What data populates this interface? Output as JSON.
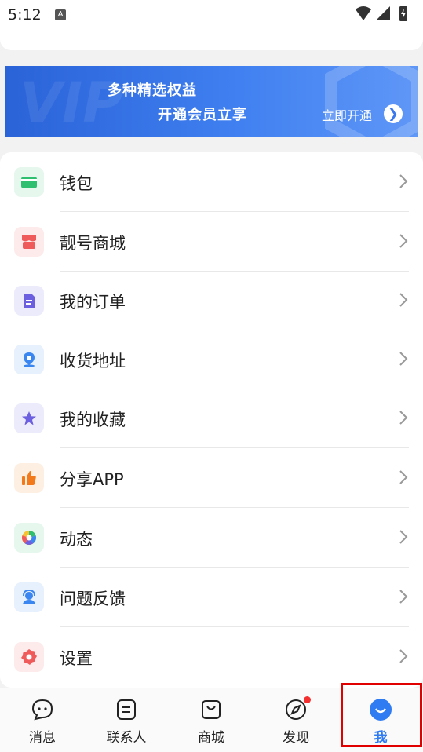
{
  "status_bar": {
    "time": "5:12",
    "notif_letter": "A"
  },
  "vip_banner": {
    "line1": "多种精选权益",
    "line2": "开通会员立享",
    "cta": "立即开通",
    "deco_text": "VIP"
  },
  "menu": {
    "items": [
      {
        "label": "钱包",
        "icon": "wallet-icon",
        "color": "#2fbf71",
        "bg": "#e6f7ee"
      },
      {
        "label": "靓号商城",
        "icon": "store-icon",
        "color": "#ef5b5b",
        "bg": "#fdeaea"
      },
      {
        "label": "我的订单",
        "icon": "order-icon",
        "color": "#6c5fe0",
        "bg": "#ecebfb"
      },
      {
        "label": "收货地址",
        "icon": "location-icon",
        "color": "#3a86f0",
        "bg": "#e7f0fd"
      },
      {
        "label": "我的收藏",
        "icon": "star-icon",
        "color": "#6c5fe0",
        "bg": "#ecebfb"
      },
      {
        "label": "分享APP",
        "icon": "thumbs-up-icon",
        "color": "#f27a1a",
        "bg": "#fdefe2"
      },
      {
        "label": "动态",
        "icon": "aperture-icon",
        "color": "#2fbf71",
        "bg": "#e6f7ee"
      },
      {
        "label": "问题反馈",
        "icon": "support-icon",
        "color": "#3a86f0",
        "bg": "#e7f0fd"
      },
      {
        "label": "设置",
        "icon": "gear-icon",
        "color": "#ef5b5b",
        "bg": "#fdeaea"
      }
    ]
  },
  "tabbar": {
    "tabs": [
      {
        "label": "消息",
        "icon": "message-icon"
      },
      {
        "label": "联系人",
        "icon": "contacts-icon"
      },
      {
        "label": "商城",
        "icon": "shop-bag-icon"
      },
      {
        "label": "发现",
        "icon": "compass-icon",
        "badge_dot": true
      },
      {
        "label": "我",
        "icon": "profile-icon",
        "active": true
      }
    ],
    "active_color": "#2f7bf2"
  }
}
